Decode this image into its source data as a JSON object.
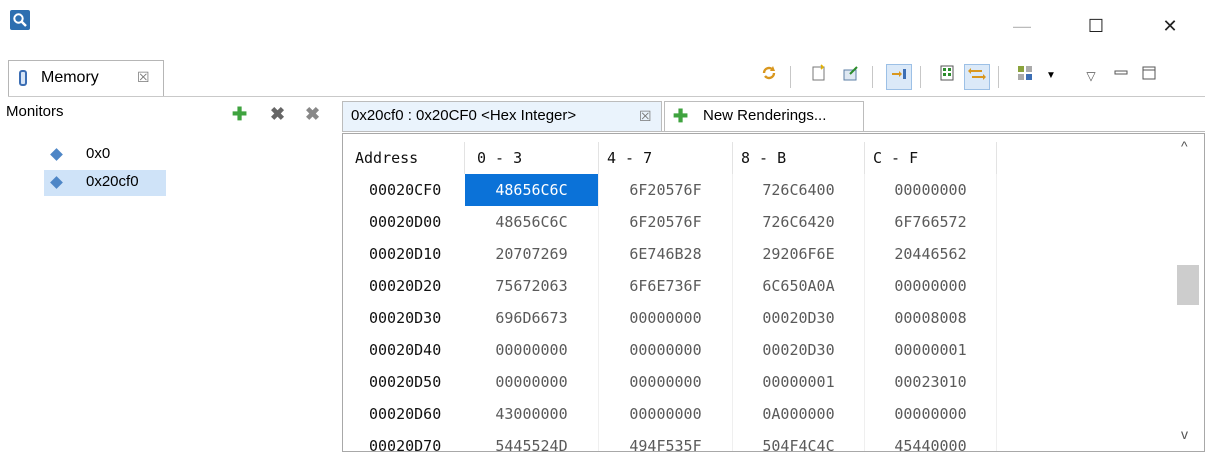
{
  "window": {
    "minimize_symbol": "—",
    "maximize_symbol": "☐",
    "close_symbol": "✕",
    "icon": "magnifier-icon"
  },
  "view_tab": {
    "label": "Memory",
    "close_symbol": "☒"
  },
  "toolbar": {
    "icons": [
      "refresh-icon",
      "new-file-icon",
      "export-icon",
      "link-icon",
      "columns-icon",
      "swap-icon",
      "layout-icon",
      "dropdown-icon",
      "view-menu-icon",
      "minimize-view-icon",
      "maximize-view-icon"
    ]
  },
  "monitors": {
    "title": "Monitors",
    "add_symbol": "✚",
    "remove_symbol": "✖",
    "remove_all_symbol": "✖",
    "items": [
      {
        "label": "0x0",
        "selected": false
      },
      {
        "label": "0x20cf0",
        "selected": true
      }
    ]
  },
  "renderings": {
    "tabs": [
      {
        "label": "0x20cf0 : 0x20CF0 <Hex Integer>",
        "close_symbol": "☒",
        "active": true
      },
      {
        "label": "New Renderings...",
        "icon": "plus-icon",
        "active": false
      }
    ]
  },
  "memory_table": {
    "columns": [
      "Address",
      "0 - 3",
      "4 - 7",
      "8 - B",
      "C - F"
    ],
    "rows": [
      {
        "address": "00020CF0",
        "values": [
          "48656C6C",
          "6F20576F",
          "726C6400",
          "00000000"
        ]
      },
      {
        "address": "00020D00",
        "values": [
          "48656C6C",
          "6F20576F",
          "726C6420",
          "6F766572"
        ]
      },
      {
        "address": "00020D10",
        "values": [
          "20707269",
          "6E746B28",
          "29206F6E",
          "20446562"
        ]
      },
      {
        "address": "00020D20",
        "values": [
          "75672063",
          "6F6E736F",
          "6C650A0A",
          "00000000"
        ]
      },
      {
        "address": "00020D30",
        "values": [
          "696D6673",
          "00000000",
          "00020D30",
          "00008008"
        ]
      },
      {
        "address": "00020D40",
        "values": [
          "00000000",
          "00000000",
          "00020D30",
          "00000001"
        ]
      },
      {
        "address": "00020D50",
        "values": [
          "00000000",
          "00000000",
          "00000001",
          "00023010"
        ]
      },
      {
        "address": "00020D60",
        "values": [
          "43000000",
          "00000000",
          "0A000000",
          "00000000"
        ]
      },
      {
        "address": "00020D70",
        "values": [
          "5445524D",
          "494F535F",
          "504F4C4C",
          "45440000"
        ]
      }
    ],
    "selected_cell": {
      "row": 0,
      "col": 0
    },
    "selection_color": "#0b72d8",
    "scroll_up_symbol": "^",
    "scroll_down_symbol": "v"
  },
  "colors": {
    "selection": "#0b72d8",
    "monitor_selected_bg": "#cfe3f8",
    "accent": "#3c6eb4"
  }
}
